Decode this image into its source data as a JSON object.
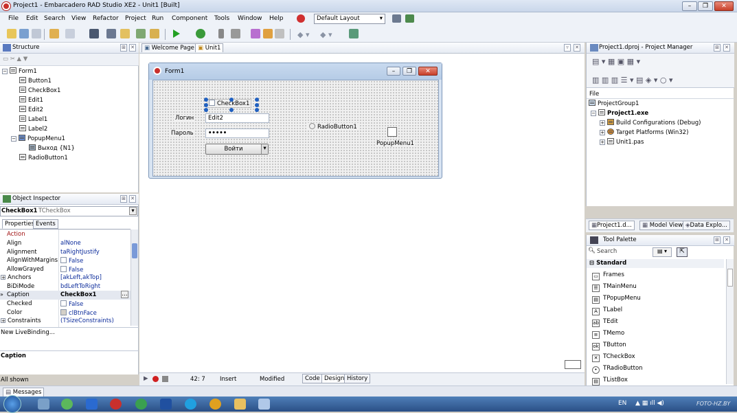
{
  "window": {
    "title": "Project1 - Embarcadero RAD Studio XE2 - Unit1 [Built]"
  },
  "menu": [
    "File",
    "Edit",
    "Search",
    "View",
    "Refactor",
    "Project",
    "Run",
    "Component",
    "Tools",
    "Window",
    "Help"
  ],
  "layout_select": "Default Layout",
  "structure": {
    "title": "Structure",
    "items": [
      "Form1",
      "Button1",
      "CheckBox1",
      "Edit1",
      "Edit2",
      "Label1",
      "Label2",
      "PopupMenu1",
      "Выход {N1}",
      "RadioButton1"
    ]
  },
  "editor_tabs": [
    "Welcome Page",
    "Unit1"
  ],
  "form": {
    "title": "Form1",
    "checkbox": "CheckBox1",
    "label_login": "Логин",
    "edit_login": "Edit2",
    "label_password": "Пароль",
    "edit_password": "•••••",
    "button": "Войти",
    "radio": "RadioButton1",
    "popup": "PopupMenu1"
  },
  "object_inspector": {
    "title": "Object Inspector",
    "selected_name": "CheckBox1",
    "selected_type": "TCheckBox",
    "tabs": [
      "Properties",
      "Events"
    ],
    "props": [
      {
        "name": "Action",
        "value": ""
      },
      {
        "name": "Align",
        "value": "alNone"
      },
      {
        "name": "Alignment",
        "value": "taRightJustify"
      },
      {
        "name": "AlignWithMargins",
        "value": "False"
      },
      {
        "name": "AllowGrayed",
        "value": "False"
      },
      {
        "name": "Anchors",
        "value": "[akLeft,akTop]"
      },
      {
        "name": "BiDiMode",
        "value": "bdLeftToRight"
      },
      {
        "name": "Caption",
        "value": "CheckBox1"
      },
      {
        "name": "Checked",
        "value": "False"
      },
      {
        "name": "Color",
        "value": "clBtnFace"
      },
      {
        "name": "Constraints",
        "value": "(TSizeConstraints)"
      }
    ],
    "livebinding": "New LiveBinding...",
    "desc_title": "Caption",
    "status": "All shown"
  },
  "statusbar": {
    "position": "42: 7",
    "mode": "Insert",
    "state": "Modified",
    "tabs": [
      "Code",
      "Design",
      "History"
    ],
    "messages": "Messages"
  },
  "project_manager": {
    "title": "Project1.dproj - Project Manager",
    "col": "File",
    "items": [
      "ProjectGroup1",
      "Project1.exe",
      "Build Configurations (Debug)",
      "Target Platforms (Win32)",
      "Unit1.pas"
    ],
    "bottom_tabs": [
      "Project1.d...",
      "Model View",
      "Data Explo..."
    ]
  },
  "tool_palette": {
    "title": "Tool Palette",
    "search_placeholder": "Search",
    "category": "Standard",
    "items": [
      "Frames",
      "TMainMenu",
      "TPopupMenu",
      "TLabel",
      "TEdit",
      "TMemo",
      "TButton",
      "TCheckBox",
      "TRadioButton",
      "TListBox"
    ]
  },
  "tray": {
    "lang": "EN",
    "watermark": "FOTO-HZ.BY"
  }
}
